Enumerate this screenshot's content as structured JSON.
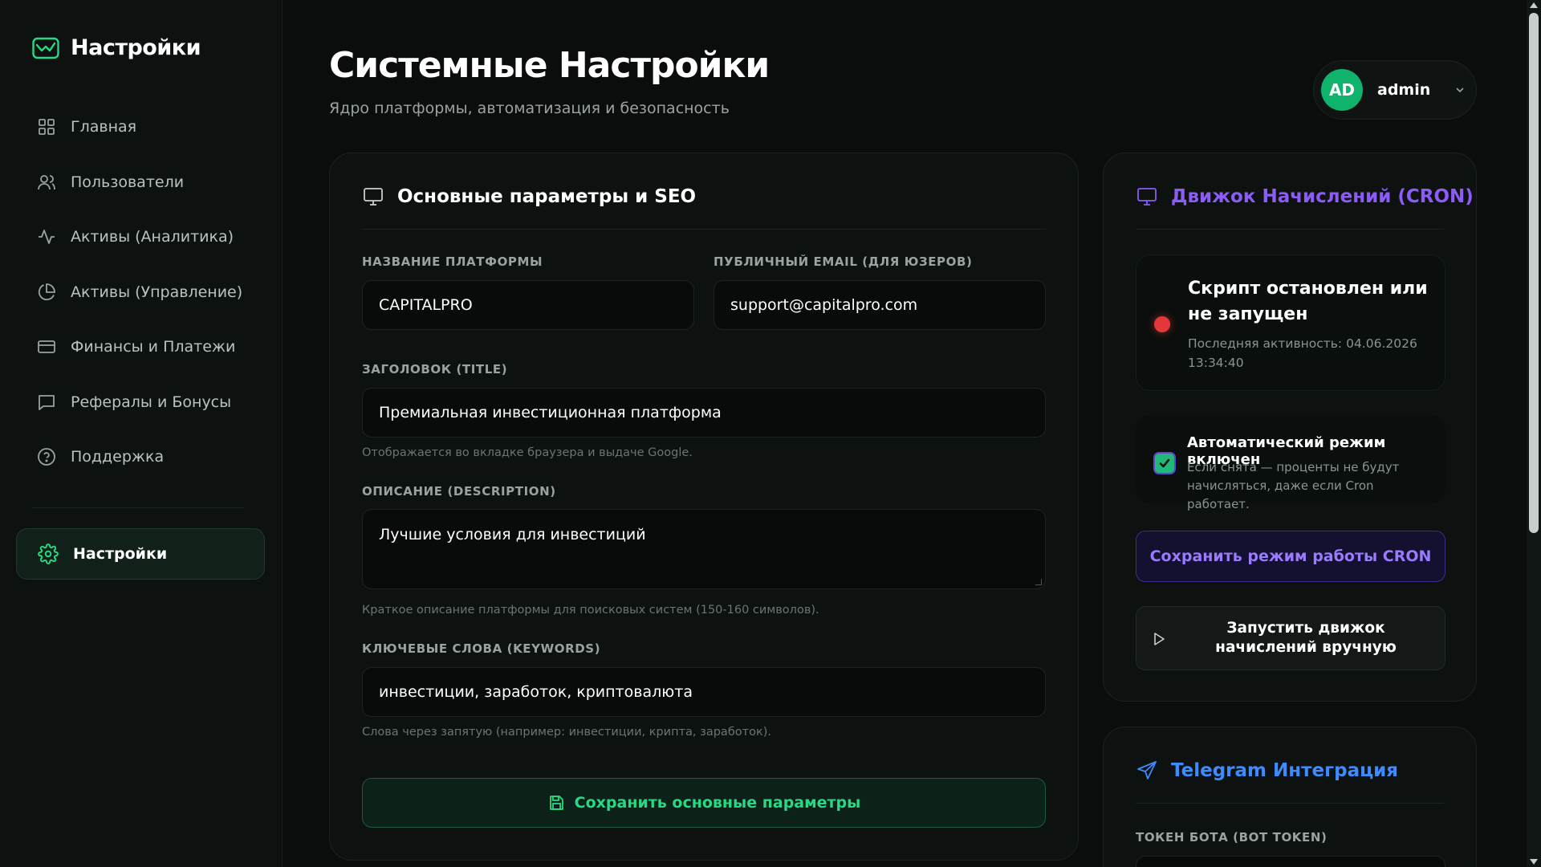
{
  "brand": {
    "title": "Настройки",
    "icon": "chart-window-icon"
  },
  "sidebar": {
    "items": [
      {
        "label": "Главная",
        "icon": "grid-icon"
      },
      {
        "label": "Пользователи",
        "icon": "users-icon"
      },
      {
        "label": "Активы (Аналитика)",
        "icon": "activity-icon"
      },
      {
        "label": "Активы (Управление)",
        "icon": "pie-chart-icon"
      },
      {
        "label": "Финансы и Платежи",
        "icon": "credit-card-icon"
      },
      {
        "label": "Рефералы и Бонусы",
        "icon": "message-icon"
      },
      {
        "label": "Поддержка",
        "icon": "help-circle-icon"
      }
    ],
    "active": {
      "label": "Настройки",
      "icon": "gear-icon"
    }
  },
  "header": {
    "title": "Системные Настройки",
    "subtitle": "Ядро платформы, автоматизация и безопасность"
  },
  "user": {
    "initials": "AD",
    "name": "admin"
  },
  "main_panel": {
    "title": "Основные параметры и SEO",
    "platform_name": {
      "label": "Название платформы",
      "value": "CAPITALPRO"
    },
    "public_email": {
      "label": "Публичный email (для юзеров)",
      "value": "support@capitalpro.com"
    },
    "title_field": {
      "label": "Заголовок (Title)",
      "value": "Премиальная инвестиционная платформа",
      "hint": "Отображается во вкладке браузера и выдаче Google."
    },
    "description_field": {
      "label": "Описание (Description)",
      "value": "Лучшие условия для инвестиций",
      "hint": "Краткое описание платформы для поисковых систем (150-160 символов)."
    },
    "keywords_field": {
      "label": "Ключевые слова (Keywords)",
      "value": "инвестиции, заработок, криптовалюта",
      "hint": "Слова через запятую (например: инвестиции, крипта, заработок)."
    },
    "save_label": "Сохранить основные параметры"
  },
  "cron_panel": {
    "title": "Движок Начислений (CRON)",
    "status_title": "Скрипт остановлен или не запущен",
    "status_sub": "Последняя активность: 04.06.2026 13:34:40",
    "status_color": "#e5383b",
    "auto_title": "Автоматический режим включен",
    "auto_sub": "Если снята — проценты не будут начисляться, даже если Cron работает.",
    "auto_checked": true,
    "save_label": "Сохранить режим работы CRON",
    "run_label": "Запустить движок начислений вручную"
  },
  "telegram_panel": {
    "title": "Telegram Интеграция",
    "token_label": "Токен бота (Bot Token)"
  },
  "colors": {
    "accent_green": "#27d884",
    "accent_purple": "#8b5cf6",
    "accent_blue": "#3d8bff",
    "avatar": "#10b36b"
  }
}
